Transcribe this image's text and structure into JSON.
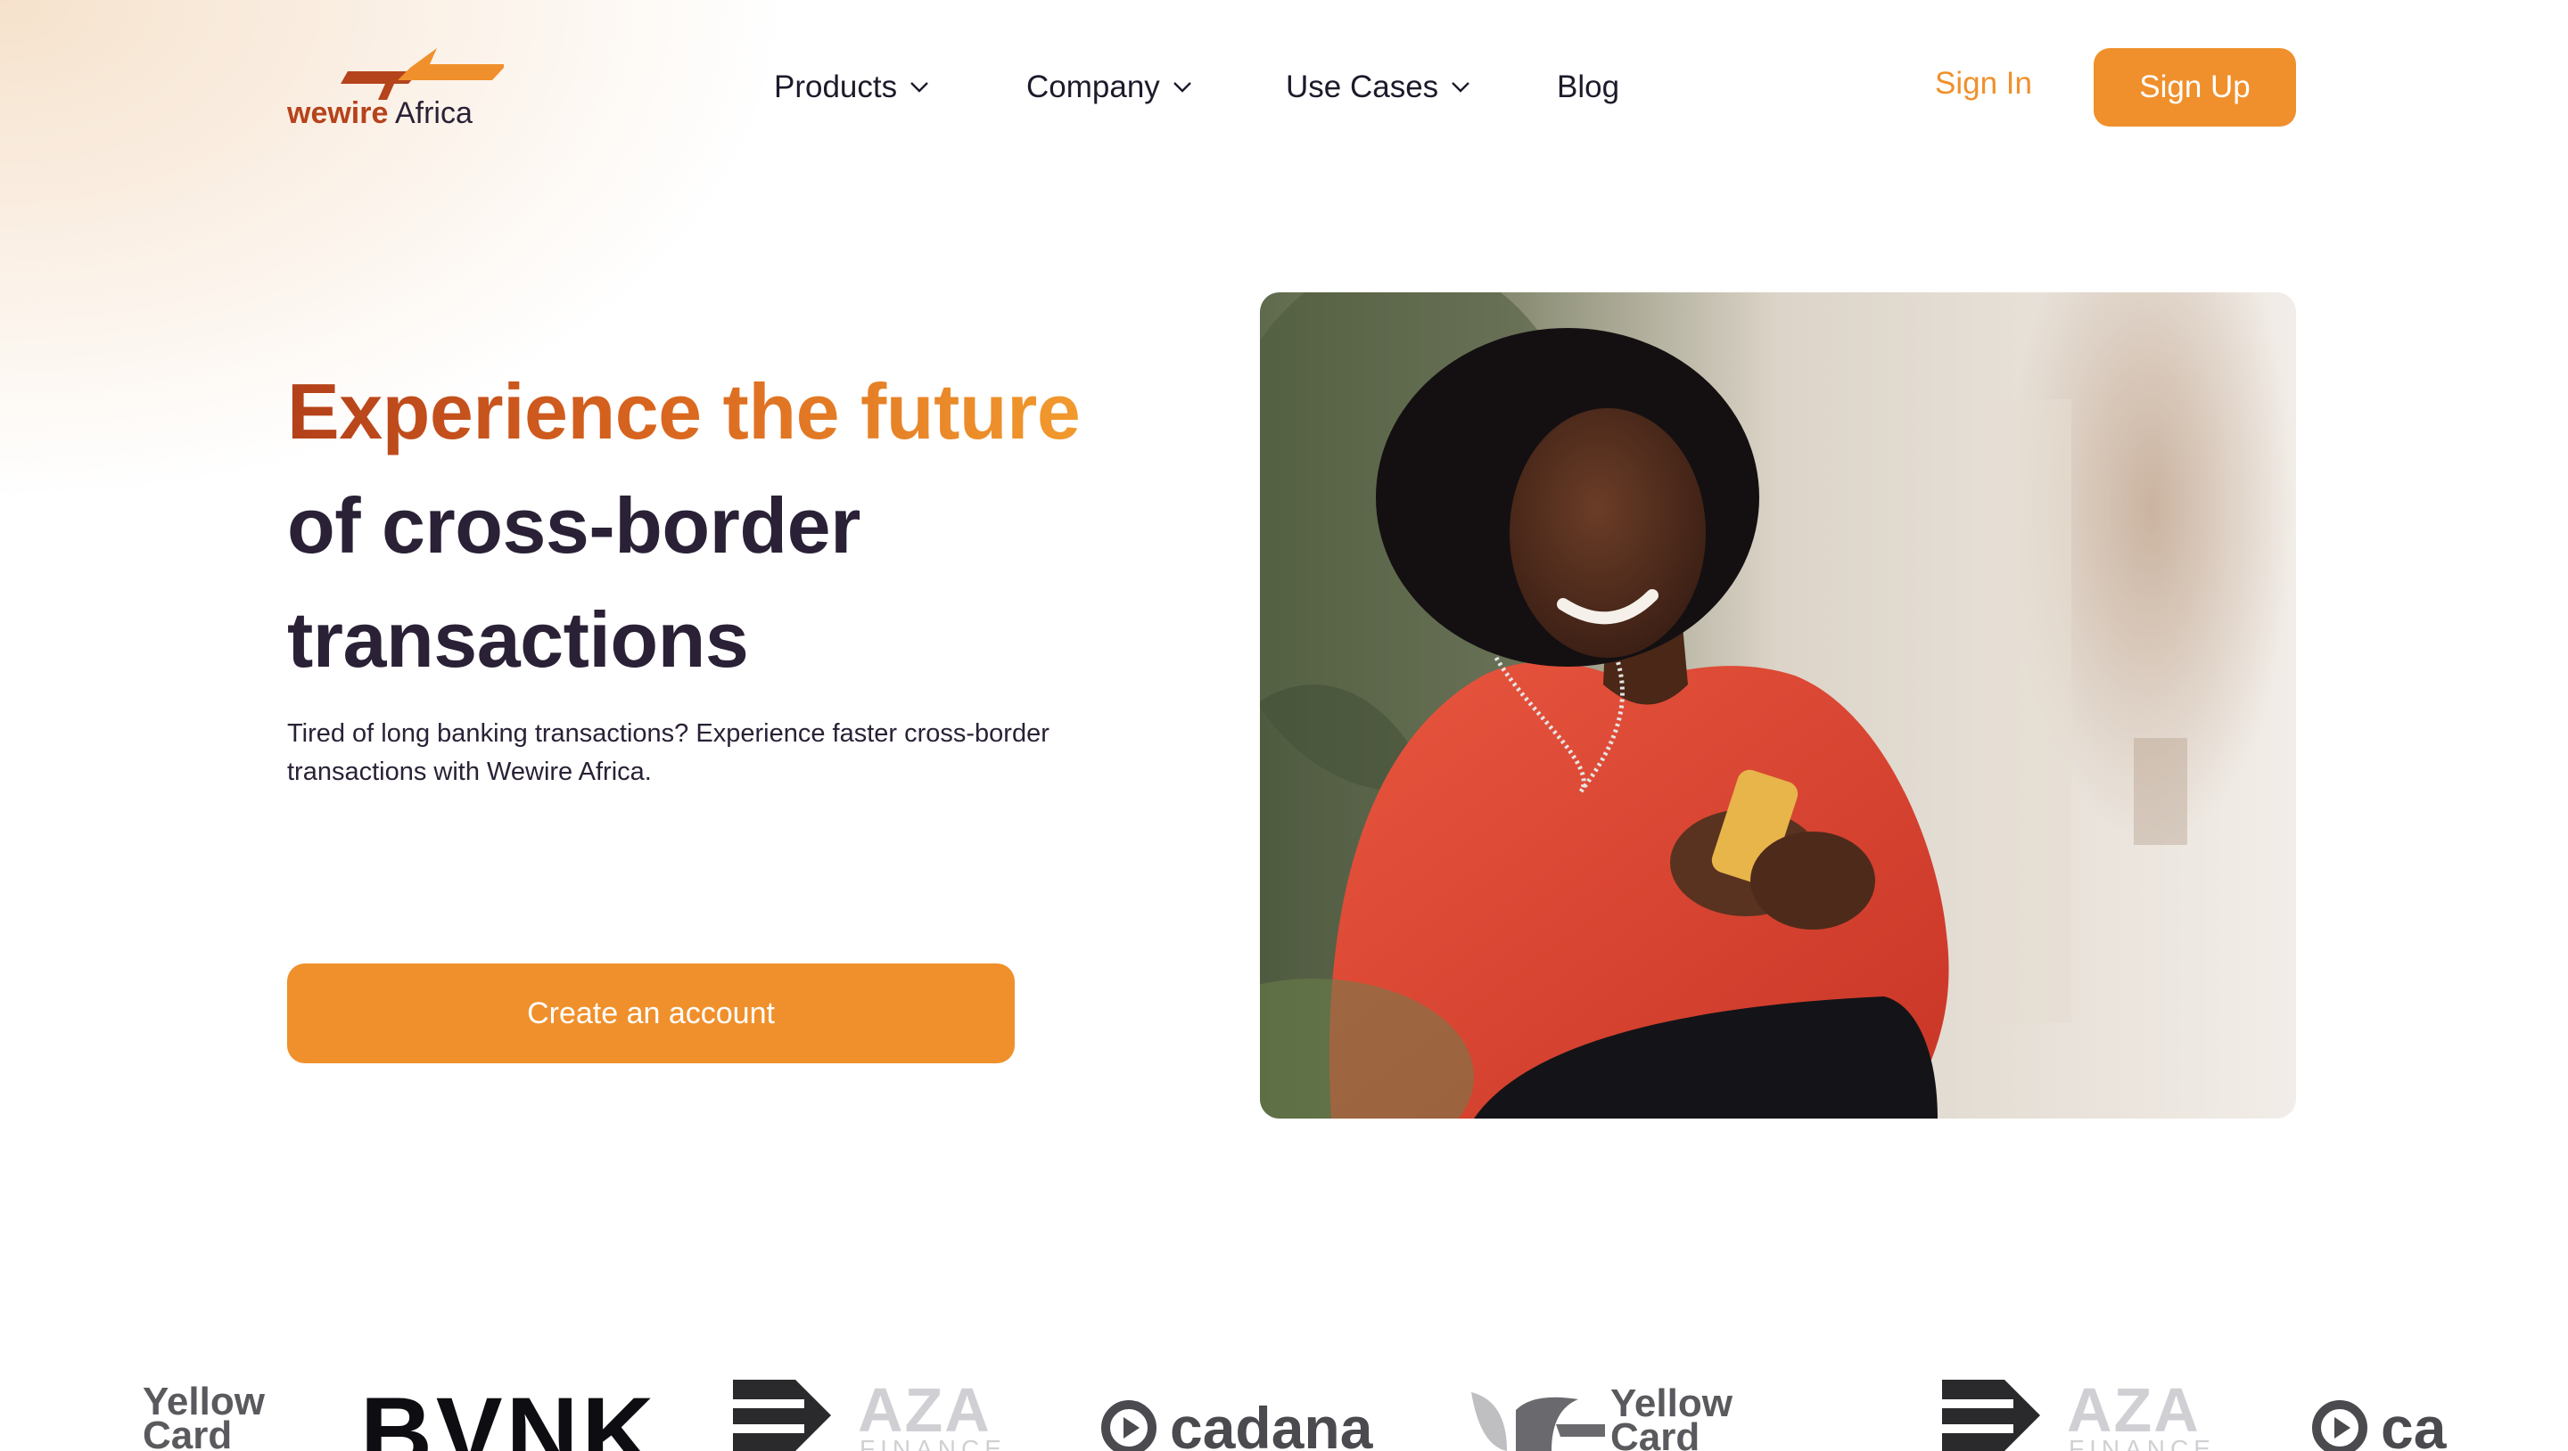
{
  "brand": {
    "name_part1": "wewire",
    "name_part2": "Africa",
    "accent": "#f0902c",
    "dark_accent": "#b5431b",
    "text_dark": "#2a2136"
  },
  "nav": {
    "items": [
      {
        "label": "Products",
        "has_dropdown": true,
        "icon": "chevron-down-icon"
      },
      {
        "label": "Company",
        "has_dropdown": true,
        "icon": "chevron-down-icon"
      },
      {
        "label": "Use Cases",
        "has_dropdown": true,
        "icon": "chevron-down-icon"
      },
      {
        "label": "Blog",
        "has_dropdown": false
      }
    ],
    "sign_in": "Sign In",
    "sign_up": "Sign Up"
  },
  "hero": {
    "title_highlight": "Experience the future",
    "title_rest_line1": "of cross-border",
    "title_rest_line2": "transactions",
    "subtitle": "Tired of long banking transactions? Experience faster cross-border transactions with Wewire Africa.",
    "cta": "Create an account",
    "image_alt": "smiling-woman-with-phone-photo"
  },
  "partners": {
    "logos": [
      {
        "name": "Yellow Card",
        "line1": "Yellow",
        "line2": "Card"
      },
      {
        "name": "BVNK",
        "text": "BVNK"
      },
      {
        "name": "AZA Finance",
        "text": "AZA",
        "sub": "FINANCE"
      },
      {
        "name": "cadana",
        "text": "cadana"
      },
      {
        "name": "Yellow Card",
        "line1": "Yellow",
        "line2": "Card"
      },
      {
        "name": "AZA Finance",
        "text": "AZA",
        "sub": "FINANCE"
      },
      {
        "name": "cadana",
        "text": "ca"
      }
    ]
  }
}
